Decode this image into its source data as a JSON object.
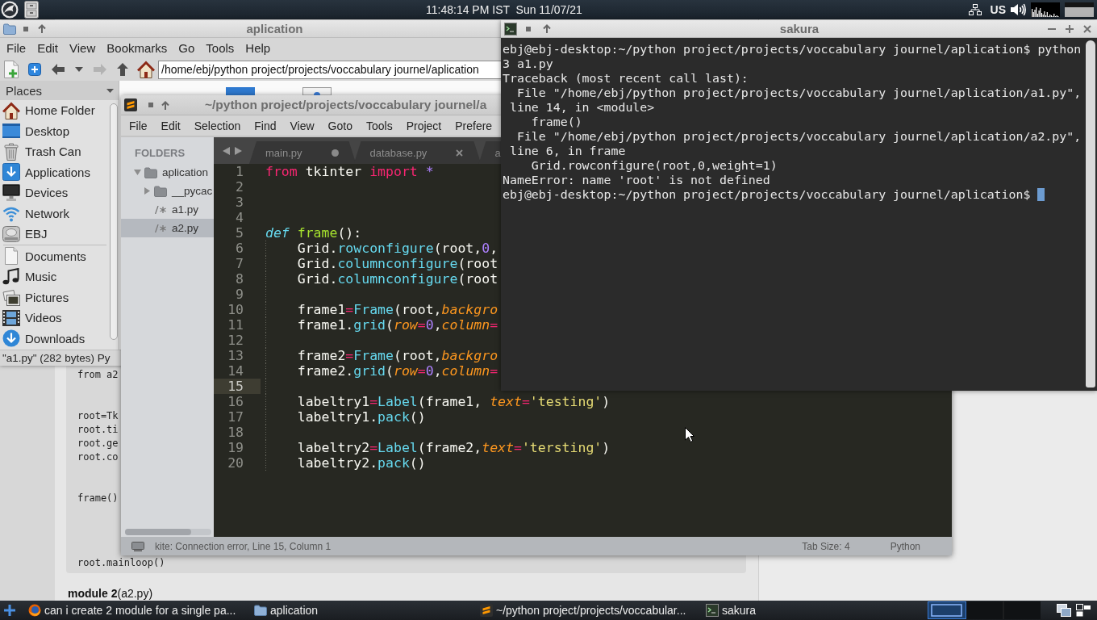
{
  "top_panel": {
    "clock": "11:48:14 PM IST  Sun 11/07/21",
    "keyboard_layout": "US"
  },
  "browser_page": {
    "code_groups": [
      [
        "from a2"
      ],
      [
        "root=Tk",
        "root.ti",
        "root.ge",
        "root.co"
      ],
      [
        "frame()"
      ],
      [
        "root.mainloop()"
      ]
    ],
    "heading": "**module 2**(a2.py)"
  },
  "file_manager": {
    "title": "aplication",
    "menu": [
      "File",
      "Edit",
      "View",
      "Bookmarks",
      "Go",
      "Tools",
      "Help"
    ],
    "toolbar": [
      {
        "kind": "new-window",
        "disabled": false
      },
      {
        "kind": "new-tab",
        "disabled": false
      },
      {
        "kind": "back",
        "disabled": false
      },
      {
        "kind": "history",
        "disabled": false
      },
      {
        "kind": "forward",
        "disabled": true
      },
      {
        "kind": "up",
        "disabled": false
      },
      {
        "kind": "home",
        "disabled": false
      }
    ],
    "path": "/home/ebj/python project/projects/voccabulary journel/aplication",
    "sidebar": {
      "title": "Places",
      "groups": [
        {
          "items": [
            {
              "label": "Home Folder",
              "kind": "home",
              "selected": false
            },
            {
              "label": "Desktop",
              "kind": "desktop",
              "selected": false
            },
            {
              "label": "Trash Can",
              "kind": "trash",
              "selected": false
            },
            {
              "label": "Applications",
              "kind": "applications",
              "selected": false
            },
            {
              "label": "Devices",
              "kind": "devices",
              "selected": false
            },
            {
              "label": "Network",
              "kind": "network",
              "selected": false
            },
            {
              "label": "EBJ",
              "kind": "drive",
              "selected": false
            }
          ]
        },
        {
          "items": [
            {
              "label": "Documents",
              "kind": "documents",
              "selected": false
            },
            {
              "label": "Music",
              "kind": "music",
              "selected": false
            },
            {
              "label": "Pictures",
              "kind": "pictures",
              "selected": false
            },
            {
              "label": "Videos",
              "kind": "videos",
              "selected": false
            },
            {
              "label": "Downloads",
              "kind": "downloads",
              "selected": false
            }
          ]
        }
      ]
    },
    "status": "\"a1.py\" (282 bytes) Py"
  },
  "editor": {
    "title": "~/python project/projects/voccabulary journel/a",
    "menu": [
      "File",
      "Edit",
      "Selection",
      "Find",
      "View",
      "Goto",
      "Tools",
      "Project",
      "Prefere"
    ],
    "sidebar": {
      "title": "FOLDERS",
      "tree": [
        {
          "label": "aplication",
          "kind": "folder",
          "expanded": true,
          "selected": false,
          "children": [
            {
              "label": "__pycac",
              "kind": "folder",
              "expanded": false,
              "selected": false
            },
            {
              "label": "a1.py",
              "kind": "file",
              "selected": false
            },
            {
              "label": "a2.py",
              "kind": "file",
              "selected": true
            }
          ]
        }
      ]
    },
    "tabs": [
      {
        "label": "main.py",
        "modified": true,
        "selected": false
      },
      {
        "label": "database.py",
        "modified": false,
        "selected": false
      },
      {
        "label": "a",
        "selected": false
      }
    ],
    "lines": [
      {
        "number": "1",
        "current": false,
        "tokens": [
          {
            "kind": "keyword",
            "text": "from"
          },
          {
            "kind": "plain",
            "text": " tkinter "
          },
          {
            "kind": "keyword",
            "text": "import"
          },
          {
            "kind": "constant",
            "text": " *"
          }
        ]
      },
      {
        "number": "2",
        "current": false
      },
      {
        "number": "3",
        "current": false
      },
      {
        "number": "4",
        "current": false
      },
      {
        "number": "5",
        "current": false,
        "tokens": [
          {
            "kind": "storage",
            "text": "def"
          },
          {
            "kind": "function",
            "text": " frame"
          },
          {
            "kind": "plain",
            "text": "():"
          }
        ],
        "children": [
          {
            "number": "6",
            "current": false,
            "tokens": [
              {
                "kind": "plain",
                "text": "Grid."
              },
              {
                "kind": "support",
                "text": "rowconfigure"
              },
              {
                "kind": "plain",
                "text": "(root,"
              },
              {
                "kind": "constant",
                "text": "0"
              },
              {
                "kind": "plain",
                "text": ","
              }
            ]
          },
          {
            "number": "7",
            "current": false,
            "tokens": [
              {
                "kind": "plain",
                "text": "Grid."
              },
              {
                "kind": "support",
                "text": "columnconfigure"
              },
              {
                "kind": "plain",
                "text": "(root"
              }
            ]
          },
          {
            "number": "8",
            "current": false,
            "tokens": [
              {
                "kind": "plain",
                "text": "Grid."
              },
              {
                "kind": "support",
                "text": "columnconfigure"
              },
              {
                "kind": "plain",
                "text": "(root"
              }
            ]
          },
          {
            "number": "9",
            "current": false
          },
          {
            "number": "10",
            "current": false,
            "tokens": [
              {
                "kind": "plain",
                "text": "frame1"
              },
              {
                "kind": "keyword",
                "text": "="
              },
              {
                "kind": "support",
                "text": "Frame"
              },
              {
                "kind": "plain",
                "text": "(root,"
              },
              {
                "kind": "parameter",
                "text": "backgro"
              }
            ]
          },
          {
            "number": "11",
            "current": false,
            "tokens": [
              {
                "kind": "plain",
                "text": "frame1."
              },
              {
                "kind": "support",
                "text": "grid"
              },
              {
                "kind": "plain",
                "text": "("
              },
              {
                "kind": "parameter",
                "text": "row"
              },
              {
                "kind": "keyword",
                "text": "="
              },
              {
                "kind": "constant",
                "text": "0"
              },
              {
                "kind": "plain",
                "text": ","
              },
              {
                "kind": "parameter",
                "text": "column"
              },
              {
                "kind": "keyword",
                "text": "="
              }
            ]
          },
          {
            "number": "12",
            "current": false
          },
          {
            "number": "13",
            "current": false,
            "tokens": [
              {
                "kind": "plain",
                "text": "frame2"
              },
              {
                "kind": "keyword",
                "text": "="
              },
              {
                "kind": "support",
                "text": "Frame"
              },
              {
                "kind": "plain",
                "text": "(root,"
              },
              {
                "kind": "parameter",
                "text": "backgro"
              }
            ]
          },
          {
            "number": "14",
            "current": false,
            "tokens": [
              {
                "kind": "plain",
                "text": "frame2."
              },
              {
                "kind": "support",
                "text": "grid"
              },
              {
                "kind": "plain",
                "text": "("
              },
              {
                "kind": "parameter",
                "text": "row"
              },
              {
                "kind": "keyword",
                "text": "="
              },
              {
                "kind": "constant",
                "text": "0"
              },
              {
                "kind": "plain",
                "text": ","
              },
              {
                "kind": "parameter",
                "text": "column"
              },
              {
                "kind": "keyword",
                "text": "="
              }
            ]
          },
          {
            "number": "15",
            "current": true
          },
          {
            "number": "16",
            "current": false,
            "tokens": [
              {
                "kind": "plain",
                "text": "labeltry1"
              },
              {
                "kind": "keyword",
                "text": "="
              },
              {
                "kind": "support",
                "text": "Label"
              },
              {
                "kind": "plain",
                "text": "(frame1, "
              },
              {
                "kind": "parameter",
                "text": "text"
              },
              {
                "kind": "keyword",
                "text": "="
              },
              {
                "kind": "string",
                "text": "'testing'"
              },
              {
                "kind": "plain",
                "text": ")"
              }
            ]
          },
          {
            "number": "17",
            "current": false,
            "tokens": [
              {
                "kind": "plain",
                "text": "labeltry1."
              },
              {
                "kind": "support",
                "text": "pack"
              },
              {
                "kind": "plain",
                "text": "()"
              }
            ]
          },
          {
            "number": "18",
            "current": false
          },
          {
            "number": "19",
            "current": false,
            "tokens": [
              {
                "kind": "plain",
                "text": "labeltry2"
              },
              {
                "kind": "keyword",
                "text": "="
              },
              {
                "kind": "support",
                "text": "Label"
              },
              {
                "kind": "plain",
                "text": "(frame2,"
              },
              {
                "kind": "parameter",
                "text": "text"
              },
              {
                "kind": "keyword",
                "text": "="
              },
              {
                "kind": "string",
                "text": "'tersting'"
              },
              {
                "kind": "plain",
                "text": ")"
              }
            ]
          },
          {
            "number": "20",
            "current": false,
            "tokens": [
              {
                "kind": "plain",
                "text": "labeltry2."
              },
              {
                "kind": "support",
                "text": "pack"
              },
              {
                "kind": "plain",
                "text": "()"
              }
            ]
          }
        ]
      }
    ],
    "status_bar": {
      "message": "kite: Connection error, Line 15, Column 1",
      "tab_size": "Tab Size: 4",
      "syntax": "Python"
    }
  },
  "terminal": {
    "title": "sakura",
    "lines": [
      "ebj@ebj-desktop:~/python project/projects/voccabulary journel/aplication$ python",
      "3 a1.py",
      "Traceback (most recent call last):",
      "  File \"/home/ebj/python project/projects/voccabulary journel/aplication/a1.py\",",
      " line 14, in <module>",
      "    frame()",
      "  File \"/home/ebj/python project/projects/voccabulary journel/aplication/a2.py\",",
      " line 6, in frame",
      "    Grid.rowconfigure(root,0,weight=1)",
      "NameError: name 'root' is not defined",
      "ebj@ebj-desktop:~/python project/projects/voccabulary journel/aplication$ "
    ],
    "cursor": true
  },
  "taskbar": {
    "tasks": [
      {
        "label": "can i create 2 module for a single pa...",
        "kind": "browser",
        "selected": false
      },
      {
        "label": "aplication",
        "kind": "folder",
        "selected": false
      },
      {
        "label": "~/python project/projects/voccabular...",
        "kind": "editor",
        "selected": false
      },
      {
        "label": "sakura",
        "kind": "terminal",
        "selected": false
      }
    ]
  }
}
